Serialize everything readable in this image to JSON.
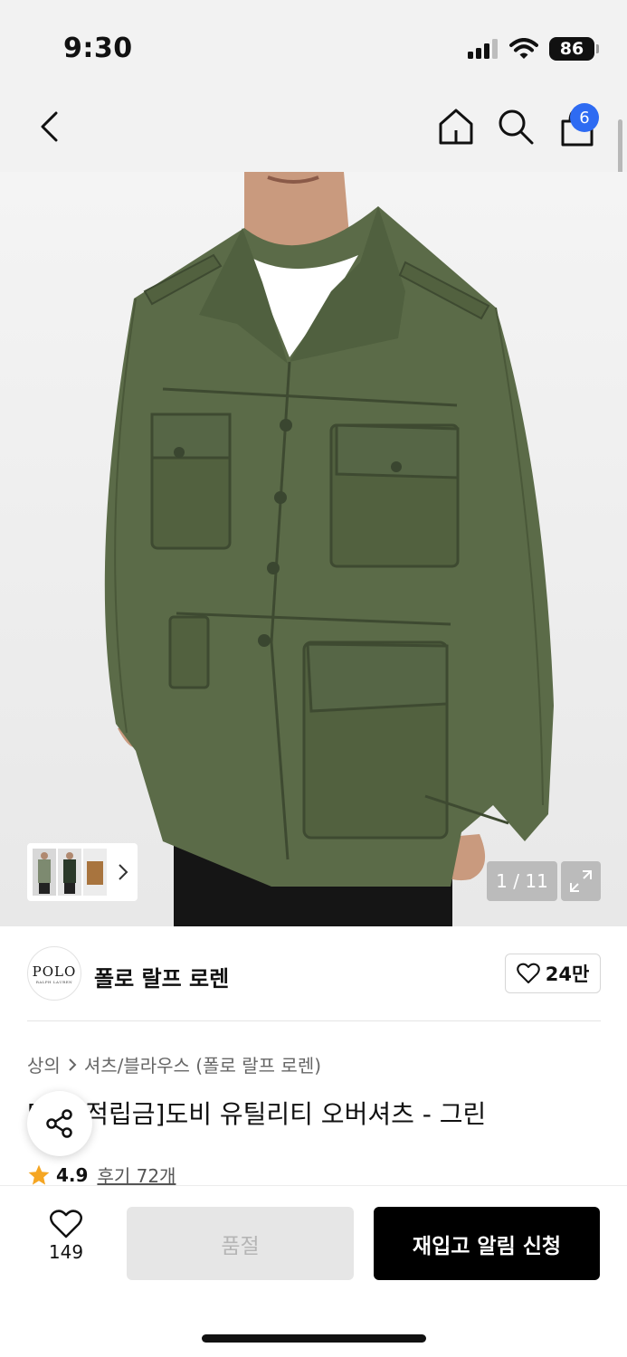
{
  "status_bar": {
    "time": "9:30",
    "battery": "86"
  },
  "nav": {
    "cart_count": "6"
  },
  "gallery": {
    "counter": "1 / 11"
  },
  "brand": {
    "logo_text": "POLO",
    "logo_subtext": "RALPH LAUREN",
    "name": "폴로 랄프 로렌",
    "likes": "24만"
  },
  "product": {
    "breadcrumb": [
      "상의",
      "셔츠/블라우스 (폴로 랄프 로렌)"
    ],
    "title": "[5% 적립금]도비 유틸리티 오버셔츠 - 그린",
    "rating": "4.9",
    "reviews": "후기 72개"
  },
  "bottom": {
    "wish_count": "149",
    "soldout_label": "품절",
    "restock_label": "재입고 알림 신청"
  },
  "colors": {
    "accent": "#2e6bf2",
    "star": "#f5a623",
    "jacket": "#5b6b48",
    "primary_button": "#000000"
  }
}
